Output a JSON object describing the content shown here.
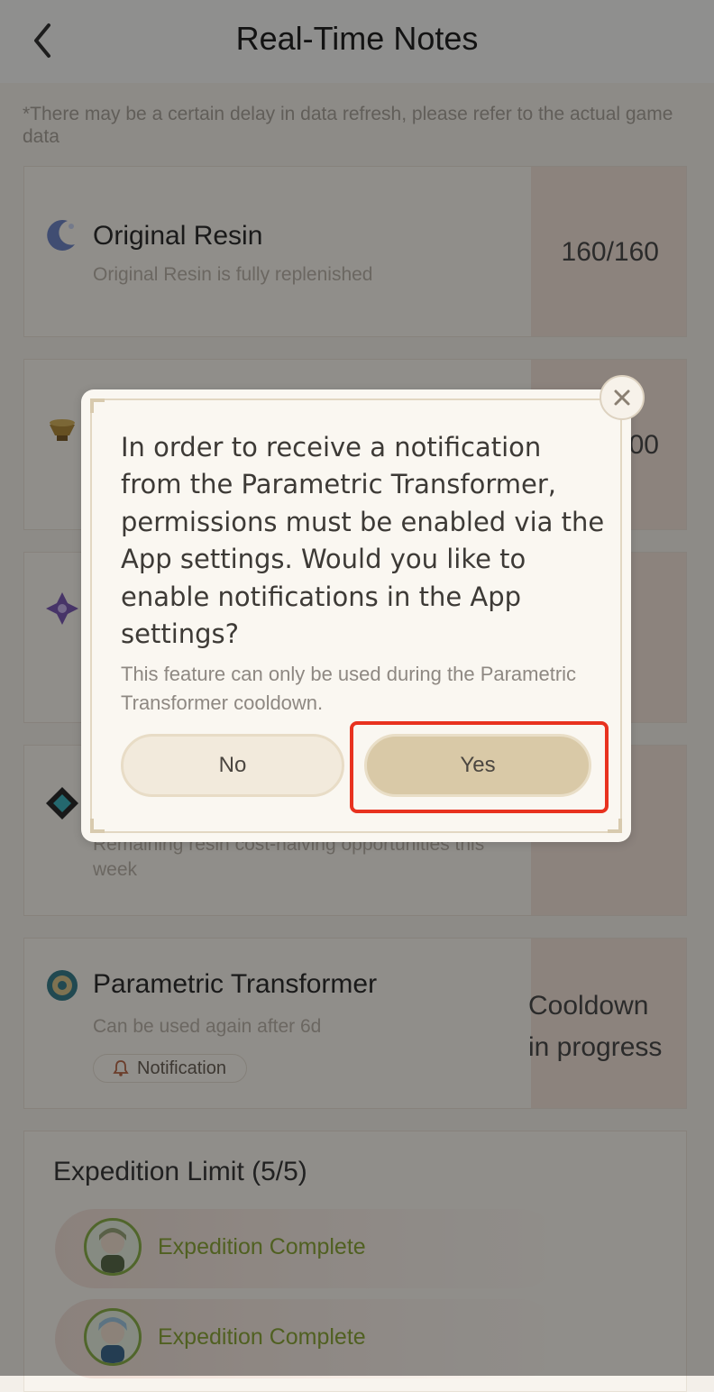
{
  "header": {
    "title": "Real-Time Notes"
  },
  "disclaimer": "*There may be a certain delay in data refresh, please refer to the actual game data",
  "cards": {
    "resin": {
      "title": "Original Resin",
      "subtitle": "Original Resin is fully replenished",
      "value": "160/160"
    },
    "realm_currency": {
      "value_partial": "400"
    },
    "resin_discounts": {
      "subtitle": "Remaining resin cost-halving opportunities this week"
    },
    "transformer": {
      "title": "Parametric Transformer",
      "subtitle": "Can be used again after 6d",
      "value": "Cooldown in progress",
      "notification_label": "Notification"
    }
  },
  "expedition": {
    "title": "Expedition Limit (5/5)",
    "items": [
      {
        "status": "Expedition Complete"
      },
      {
        "status": "Expedition Complete"
      }
    ]
  },
  "dialog": {
    "message": "In order to receive a notification from the Parametric Transformer, permissions must be enabled via the App settings. Would you like to enable notifications in the App settings?",
    "note": "This feature can only be used during the Parametric Transformer cooldown.",
    "no_label": "No",
    "yes_label": "Yes"
  },
  "colors": {
    "highlight": "#e8321f",
    "expedition_text": "#8ba63a",
    "value_bg": "#f2e2d7"
  }
}
